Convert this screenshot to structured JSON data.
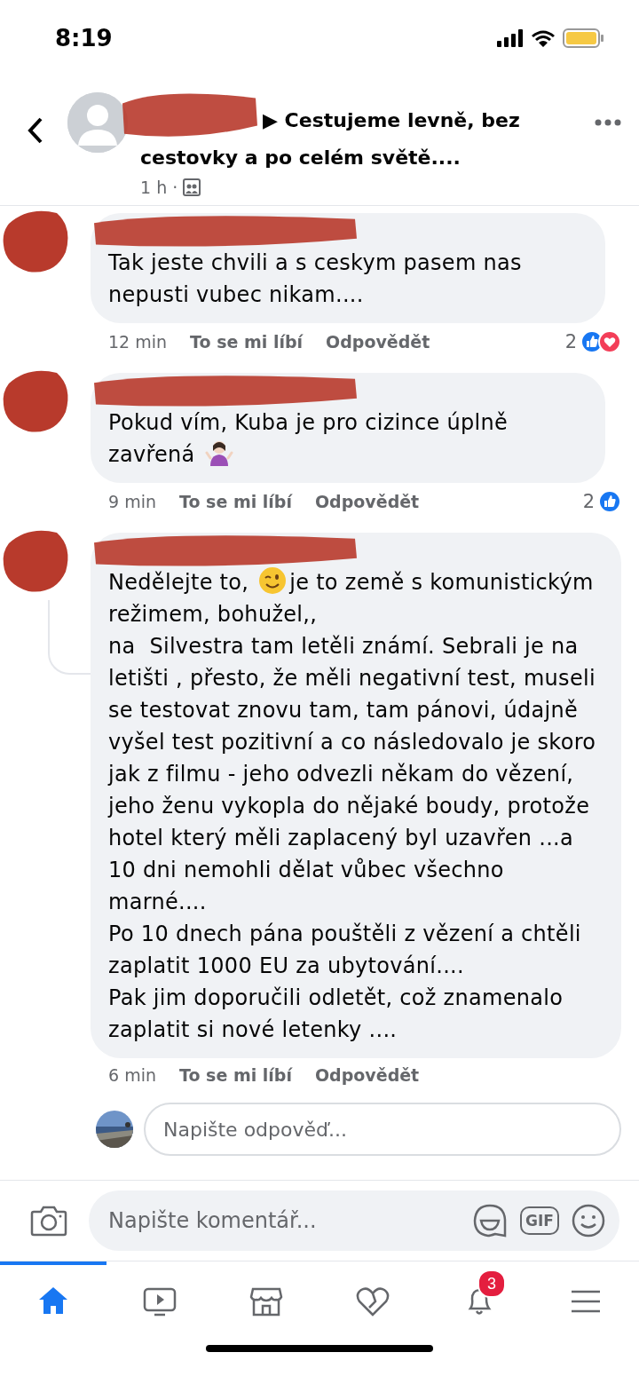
{
  "status_bar": {
    "time": "8:19"
  },
  "header": {
    "title_lines": [
      "▶ Cestujeme levně, bez",
      "cestovky a po celém světě...."
    ],
    "meta": "1 h ·"
  },
  "comments": [
    {
      "paragraphs": [
        [
          {
            "text": "Tak jeste chvili a s ceskym pasem nas nepusti vubec nikam...."
          }
        ]
      ],
      "time": "12 min",
      "like": "To se mi líbí",
      "reply": "Odpovědět",
      "reaction_count": "2",
      "reactions": [
        {
          "kind": "like"
        },
        {
          "kind": "love"
        }
      ]
    },
    {
      "paragraphs": [
        [
          {
            "text": "Pokud vím, Kuba je pro cizince úplně zavřená "
          },
          {
            "kind": "shrug"
          }
        ]
      ],
      "time": "9 min",
      "like": "To se mi líbí",
      "reply": "Odpovědět",
      "reaction_count": "2",
      "reactions": [
        {
          "kind": "like"
        }
      ]
    },
    {
      "paragraphs": [
        [
          {
            "text": "Nedělejte to, "
          },
          {
            "kind": "wink"
          },
          {
            "text": "je to země s komunistickým"
          }
        ],
        [
          {
            "text": "režimem, bohužel,,"
          }
        ],
        [
          {
            "text": "na  Silvestra tam letěli známí. Sebrali je na letišti , přesto, že měli negativní test, museli se testovat znovu tam, tam pánovi, údajně vyšel test pozitivní a co následovalo je skoro jak z filmu - jeho odvezli někam do vězení, jeho ženu vykopla do nějaké boudy, protože hotel který měli zaplacený byl uzavřen ...a 10 dni nemohli dělat vůbec všechno marné...."
          }
        ],
        [
          {
            "text": "Po 10 dnech pána pouštěli z vězení a chtěli zaplatit 1000 EU za ubytování...."
          }
        ],
        [
          {
            "text": "Pak jim doporučili odletět, což znamenalo zaplatit si nové letenky ...."
          }
        ]
      ],
      "time": "6 min",
      "like": "To se mi líbí",
      "reply": "Odpovědět",
      "reply_placeholder": "Napište odpověď..."
    }
  ],
  "composer": {
    "placeholder": "Napište komentář...",
    "gif": "GIF"
  },
  "tabs": [
    {
      "kind": "home",
      "selected": true
    },
    {
      "kind": "video",
      "selected": false
    },
    {
      "kind": "marketplace",
      "selected": false
    },
    {
      "kind": "dating",
      "selected": false
    },
    {
      "kind": "notifications",
      "selected": false,
      "badge": "3"
    },
    {
      "kind": "menu",
      "selected": false
    }
  ]
}
